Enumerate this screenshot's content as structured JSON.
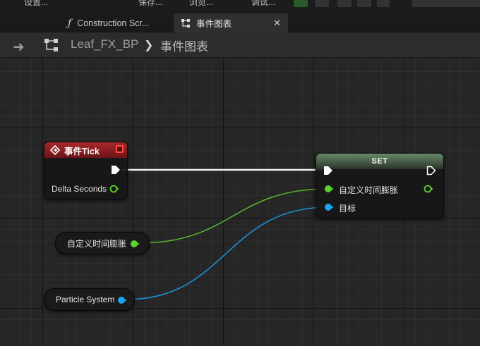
{
  "toolbar": {
    "items": [
      "设置...",
      "保存...",
      "浏览...",
      "调试..."
    ]
  },
  "tabs": [
    {
      "label": "Construction Scr...",
      "icon": "function-icon",
      "active": false
    },
    {
      "label": "事件图表",
      "icon": "event-graph-icon",
      "active": true,
      "close": "✕"
    }
  ],
  "breadcrumb": {
    "blueprint": "Leaf_FX_BP",
    "separator": "❯",
    "current": "事件图表"
  },
  "nodes": {
    "tick": {
      "title": "事件Tick",
      "pin_delta": "Delta Seconds"
    },
    "set": {
      "title": "SET",
      "pin_value": "自定义时间膨胀",
      "pin_target": "目标"
    },
    "dilation_var": {
      "label": "自定义时间膨胀"
    },
    "particle_var": {
      "label": "Particle System"
    }
  },
  "colors": {
    "exec": "#ffffff",
    "float_pin": "#5bd22e",
    "object_pin": "#1fa3ef",
    "tick_header": "#a8282a",
    "set_header": "#6a8a6a"
  }
}
